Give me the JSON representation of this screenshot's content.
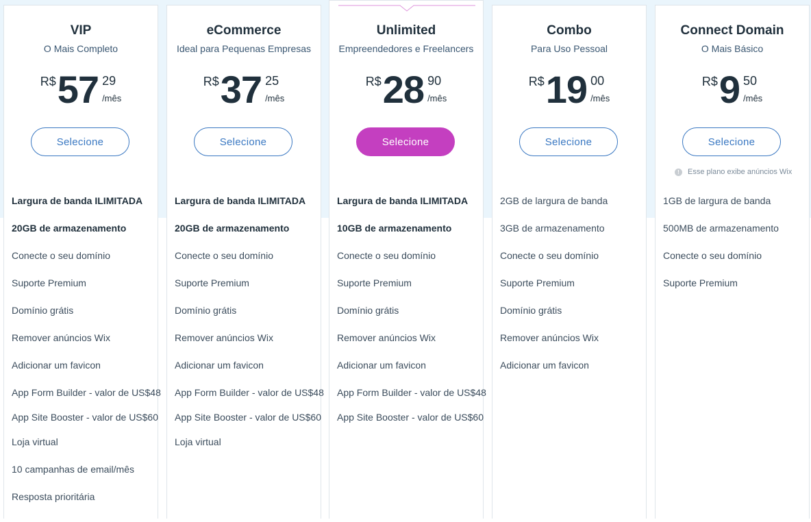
{
  "colors": {
    "accent_blue": "#3a78c2",
    "highlight_magenta": "#c43fc0",
    "text_dark": "#20303c",
    "band_bg": "#eaf5fc"
  },
  "plans": [
    {
      "name": "VIP",
      "subtitle": "O Mais Completo",
      "currency": "R$",
      "amount": "57",
      "cents": "29",
      "period": "/mês",
      "button": "Selecione",
      "features": [
        "Largura de banda ILIMITADA",
        "20GB de armazenamento",
        "Conecte o seu domínio",
        "Suporte Premium",
        "Domínio grátis",
        "Remover anúncios Wix",
        "Adicionar um favicon",
        "App Form Builder - valor de US$48",
        "App Site Booster - valor de US$60",
        "Loja virtual",
        "10 campanhas de email/mês",
        "Resposta prioritária"
      ]
    },
    {
      "name": "eCommerce",
      "subtitle": "Ideal para Pequenas Empresas",
      "currency": "R$",
      "amount": "37",
      "cents": "25",
      "period": "/mês",
      "button": "Selecione",
      "features": [
        "Largura de banda ILIMITADA",
        "20GB de armazenamento",
        "Conecte o seu domínio",
        "Suporte Premium",
        "Domínio grátis",
        "Remover anúncios Wix",
        "Adicionar um favicon",
        "App Form Builder - valor de US$48",
        "App Site Booster - valor de US$60",
        "Loja virtual"
      ]
    },
    {
      "name": "Unlimited",
      "subtitle": "Empreendedores e Freelancers",
      "currency": "R$",
      "amount": "28",
      "cents": "90",
      "period": "/mês",
      "button": "Selecione",
      "features": [
        "Largura de banda ILIMITADA",
        "10GB de armazenamento",
        "Conecte o seu domínio",
        "Suporte Premium",
        "Domínio grátis",
        "Remover anúncios Wix",
        "Adicionar um favicon",
        "App Form Builder - valor de US$48",
        "App Site Booster - valor de US$60"
      ]
    },
    {
      "name": "Combo",
      "subtitle": "Para Uso Pessoal",
      "currency": "R$",
      "amount": "19",
      "cents": "00",
      "period": "/mês",
      "button": "Selecione",
      "features": [
        "2GB de largura de banda",
        "3GB de armazenamento",
        "Conecte o seu domínio",
        "Suporte Premium",
        "Domínio grátis",
        "Remover anúncios Wix",
        "Adicionar um favicon"
      ]
    },
    {
      "name": "Connect Domain",
      "subtitle": "O Mais Básico",
      "currency": "R$",
      "amount": "9",
      "cents": "50",
      "period": "/mês",
      "button": "Selecione",
      "ad_note": "Esse plano exibe anúncios Wix",
      "ad_note_icon": "info-icon",
      "features": [
        "1GB de largura de banda",
        "500MB de armazenamento",
        "Conecte o seu domínio",
        "Suporte Premium"
      ]
    }
  ]
}
